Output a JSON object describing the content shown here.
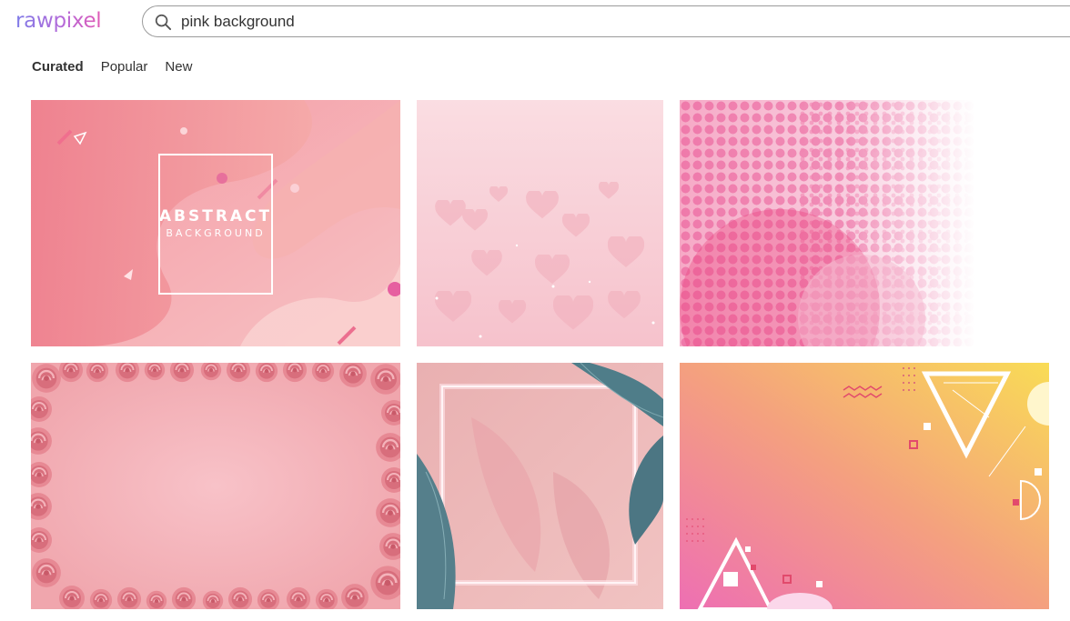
{
  "brand": {
    "logo_text": "rawpixel"
  },
  "search": {
    "value": "pink background",
    "icon": "search-icon"
  },
  "tabs": [
    {
      "label": "Curated",
      "active": true
    },
    {
      "label": "Popular",
      "active": false
    },
    {
      "label": "New",
      "active": false
    }
  ],
  "results": [
    {
      "kind": "abstract-fluid-pink",
      "title_line1": "ABSTRACT",
      "title_line2": "BACKGROUND",
      "accent": "#f08c9a"
    },
    {
      "kind": "pink-hearts",
      "accent": "#f7cdd5"
    },
    {
      "kind": "pink-halftone",
      "accent": "#ef6a9a"
    },
    {
      "kind": "rose-frame",
      "accent": "#e89aa4"
    },
    {
      "kind": "neon-frame-leaves",
      "accent": "#5f8791"
    },
    {
      "kind": "memphis-gradient",
      "accent": "#f7c86a"
    }
  ]
}
